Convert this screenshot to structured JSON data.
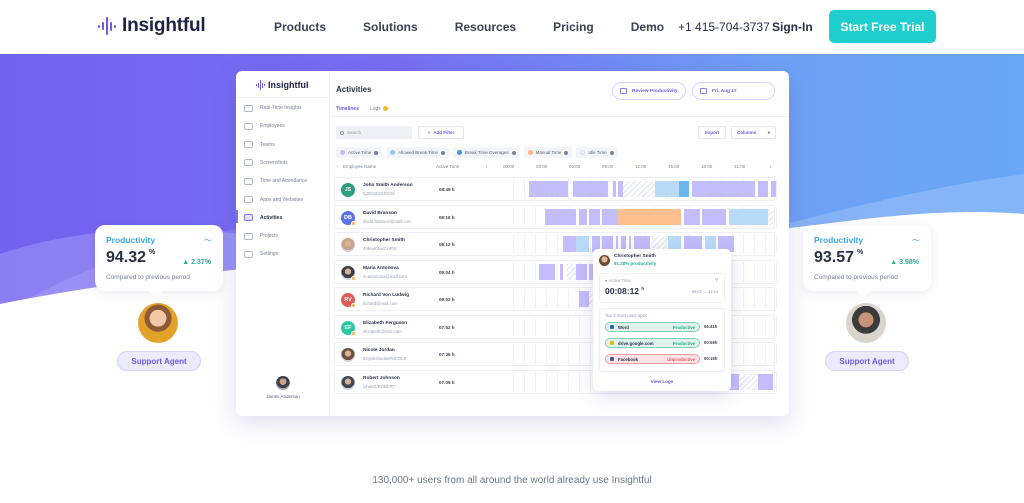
{
  "nav": {
    "brand": "Insightful",
    "links": [
      "Products",
      "Solutions",
      "Resources",
      "Pricing",
      "Demo"
    ],
    "phone": "+1 415-704-3737",
    "signin": "Sign-In",
    "cta": "Start Free Trial"
  },
  "colors": {
    "brand": "#6c5ce7",
    "cta": "#1fcfcf",
    "active_time": "#c3bdfb",
    "allowed_break": "#b8dcf7",
    "break_overage": "#6cb7ef",
    "manual_time": "#fdc08e",
    "idle_time": "#e9ebf1",
    "positive": "#2bae8f",
    "negative": "#e05a66"
  },
  "app": {
    "brand": "Insightful",
    "sidebar": [
      {
        "label": "Real-Time Insights",
        "icon": "clock-icon"
      },
      {
        "label": "Employees",
        "icon": "users-icon"
      },
      {
        "label": "Teams",
        "icon": "teams-icon"
      },
      {
        "label": "Screenshots",
        "icon": "image-icon"
      },
      {
        "label": "Time and Attendance",
        "icon": "calendar-icon"
      },
      {
        "label": "Apps and Websites",
        "icon": "monitor-icon"
      },
      {
        "label": "Activities",
        "icon": "list-icon",
        "active": true
      },
      {
        "label": "Projects",
        "icon": "briefcase-icon"
      },
      {
        "label": "Settings",
        "icon": "gear-icon"
      }
    ],
    "user": "James Anderson",
    "title": "Activities",
    "review_btn": "Review Productivity",
    "date_btn": "Fri, Aug 17",
    "tabs": [
      {
        "label": "Timelines",
        "active": true
      },
      {
        "label": "Logs",
        "badge": true
      }
    ],
    "search_placeholder": "Search",
    "add_filter": "Add Filter",
    "export": "Export",
    "columns": "Columns",
    "legend": [
      {
        "label": "Active Time",
        "color": "#c3bdfb"
      },
      {
        "label": "Allowed Break Time",
        "color": "#8fcbf3"
      },
      {
        "label": "Break Time Overages",
        "color": "#3d9be6"
      },
      {
        "label": "Manual Time",
        "color": "#fdb57c"
      },
      {
        "label": "Idle Time",
        "color": "#eceef3"
      }
    ],
    "table_headers": {
      "name": "Employee Name",
      "active": "Active Time"
    },
    "hours": [
      "00:00",
      "03:00",
      "06:00",
      "09:00",
      "12:00",
      "15:00",
      "18:00",
      "21:00"
    ],
    "rows": [
      {
        "initials": "JS",
        "bg": "#2e9e7c",
        "name": "John Smith Anderson",
        "sub": "fg202jds0/JOHN",
        "time": "08:49 h",
        "photo": false,
        "badge": false,
        "segments": [
          [
            0.06,
            0.21,
            "a"
          ],
          [
            0.23,
            0.36,
            "a"
          ],
          [
            0.38,
            0.39,
            "a"
          ],
          [
            0.4,
            0.42,
            "a"
          ],
          [
            0.42,
            0.54,
            "i"
          ],
          [
            0.54,
            0.63,
            "b"
          ],
          [
            0.63,
            0.67,
            "o"
          ],
          [
            0.68,
            0.92,
            "a"
          ],
          [
            0.93,
            0.97,
            "a"
          ],
          [
            0.98,
            1.0,
            "a"
          ]
        ]
      },
      {
        "initials": "DB",
        "bg": "#5b72e8",
        "name": "David Branson",
        "sub": "david.branson@mail.com",
        "time": "08:16 h",
        "photo": false,
        "badge": true,
        "segments": [
          [
            0.12,
            0.24,
            "a"
          ],
          [
            0.25,
            0.28,
            "a"
          ],
          [
            0.29,
            0.33,
            "a"
          ],
          [
            0.34,
            0.4,
            "a"
          ],
          [
            0.4,
            0.64,
            "m"
          ],
          [
            0.65,
            0.71,
            "a"
          ],
          [
            0.72,
            0.81,
            "a"
          ],
          [
            0.82,
            0.97,
            "b"
          ],
          [
            0.97,
            0.99,
            "i"
          ]
        ]
      },
      {
        "initials": "CS",
        "bg": "#c9a48b",
        "name": "Christopher Smith",
        "sub": "4fdewkfhs/CHRIS",
        "time": "08:12 h",
        "photo": true,
        "badge": false,
        "segments": [
          [
            0.19,
            0.24,
            "a"
          ],
          [
            0.24,
            0.29,
            "b"
          ],
          [
            0.3,
            0.33,
            "a"
          ],
          [
            0.34,
            0.38,
            "a"
          ],
          [
            0.39,
            0.4,
            "a"
          ],
          [
            0.41,
            0.43,
            "a"
          ],
          [
            0.44,
            0.45,
            "a"
          ],
          [
            0.46,
            0.52,
            "a"
          ],
          [
            0.53,
            0.58,
            "i"
          ],
          [
            0.59,
            0.64,
            "b"
          ],
          [
            0.65,
            0.72,
            "a"
          ],
          [
            0.73,
            0.77,
            "b"
          ],
          [
            0.78,
            0.84,
            "a"
          ]
        ]
      },
      {
        "initials": "MA",
        "bg": "#3d3f4a",
        "name": "Maria Antonova",
        "sub": "m.antonova@mail.com",
        "time": "08:04 h",
        "photo": true,
        "badge": true,
        "segments": [
          [
            0.1,
            0.16,
            "a"
          ],
          [
            0.18,
            0.19,
            "a"
          ],
          [
            0.2,
            0.24,
            "i"
          ],
          [
            0.24,
            0.28,
            "a"
          ],
          [
            0.29,
            0.4,
            "a"
          ]
        ]
      },
      {
        "initials": "RV",
        "bg": "#e05a5a",
        "name": "Richard Von Ludwig",
        "sub": "richard@mail.com",
        "time": "08:02 h",
        "photo": false,
        "badge": true,
        "segments": [
          [
            0.25,
            0.29,
            "a"
          ],
          [
            0.29,
            0.32,
            "i"
          ],
          [
            0.32,
            0.4,
            "a"
          ]
        ]
      },
      {
        "initials": "EF",
        "bg": "#2cc7a3",
        "name": "Elizabeth Ferguson",
        "sub": "elizabeth@mail.com",
        "time": "07:52 h",
        "photo": false,
        "badge": true,
        "segments": [
          [
            0.36,
            0.4,
            "a"
          ]
        ]
      },
      {
        "initials": "NJ",
        "bg": "#6b5244",
        "name": "Nicole Jordan",
        "sub": "82jnskshedas/NICOLE",
        "time": "07:36 h",
        "photo": true,
        "badge": false,
        "segments": []
      },
      {
        "initials": "RJ",
        "bg": "#3f4c57",
        "name": "Robert Johnson",
        "sub": "johws2/ROBERT",
        "time": "07:09 h",
        "photo": true,
        "badge": false,
        "segments": [
          [
            0.82,
            0.86,
            "a"
          ],
          [
            0.86,
            0.93,
            "i"
          ],
          [
            0.93,
            0.99,
            "a"
          ]
        ]
      }
    ],
    "tooltip": {
      "name": "Christopher Smith",
      "productivity": "91.28% productivity",
      "active_label": "Active Time",
      "active_value": "00:08:12",
      "unit": "h",
      "start": "09:02",
      "arrow": "→",
      "end": "17:14",
      "apps_title": "Top 3 most used apps",
      "apps": [
        {
          "name": "Word",
          "status": "Productive",
          "time": "06:41h",
          "kind": "good",
          "icon": "word-icon"
        },
        {
          "name": "drive.google.com",
          "status": "Productive",
          "time": "00:59h",
          "kind": "good",
          "icon": "google-drive-icon"
        },
        {
          "name": "Facebook",
          "status": "Unproductive",
          "time": "00:15h",
          "kind": "bad",
          "icon": "facebook-icon"
        }
      ],
      "view_logs": "View Logs"
    }
  },
  "cards": [
    {
      "title": "Productivity",
      "value": "94.32",
      "unit": "%",
      "delta": "▲ 2.37%",
      "caption": "Compared to previous period",
      "agent_btn": "Support Agent"
    },
    {
      "title": "Productivity",
      "value": "93.57",
      "unit": "%",
      "delta": "▲ 3.98%",
      "caption": "Compared to previous period",
      "agent_btn": "Support Agent"
    }
  ],
  "footer": {
    "text": "130,000+ users from all around the world already use Insightful"
  }
}
